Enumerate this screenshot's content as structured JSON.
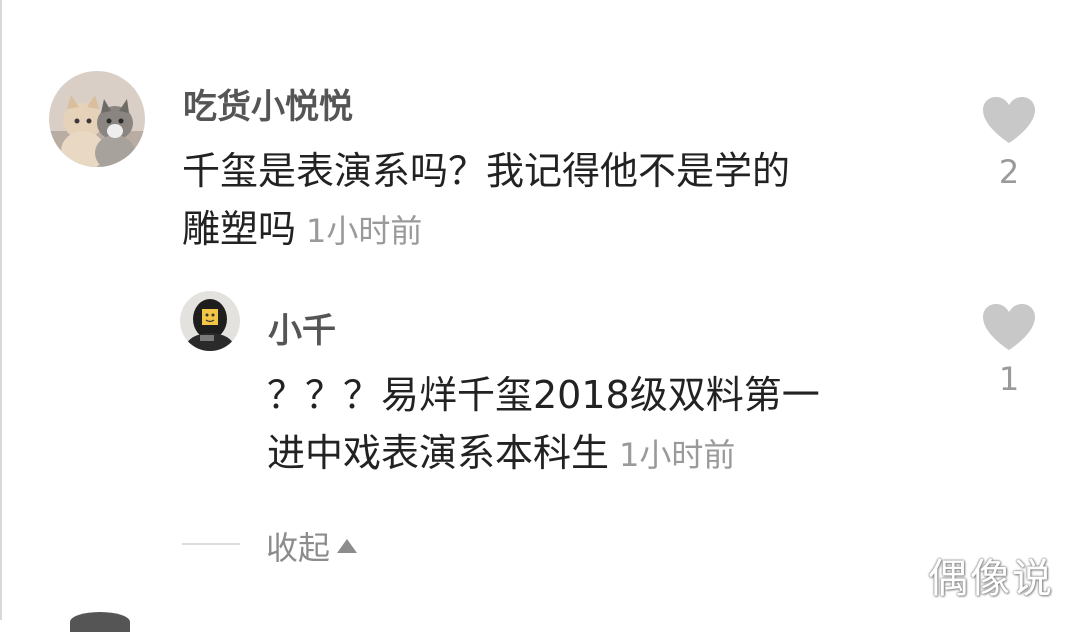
{
  "comment": {
    "username": "吃货小悦悦",
    "text_line1": "千玺是表演系吗？我记得他不是学的",
    "text_line2": "雕塑吗",
    "time": "1小时前",
    "like_count": "2"
  },
  "reply": {
    "username": "小千",
    "text_line1": "？？？易烊千玺2018级双料第一",
    "text_line2": "进中戏表演系本科生",
    "time": "1小时前",
    "like_count": "1"
  },
  "collapse_label": "收起",
  "watermark": "偶像说",
  "colors": {
    "username": "#555555",
    "text": "#222222",
    "meta": "#9a9a9a",
    "heart": "#c8c8c8"
  }
}
